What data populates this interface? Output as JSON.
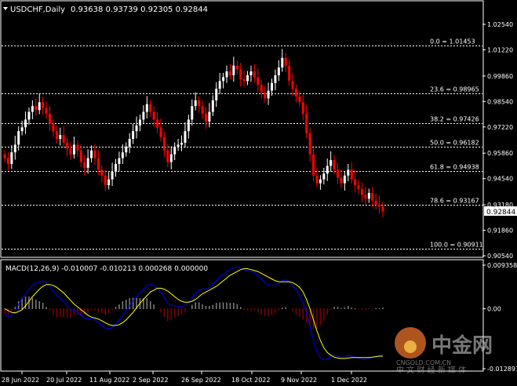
{
  "main": {
    "title": "USDCHF,Daily",
    "ohlc": "0.93638 0.93739 0.92305 0.92844",
    "price_axis": [
      "1.02540",
      "1.01220",
      "0.99860",
      "0.98540",
      "0.97220",
      "0.95860",
      "0.94540",
      "0.93180",
      "0.91860",
      "0.90540"
    ],
    "price_tag": "0.92844",
    "fib_levels": [
      {
        "label": "0.0 = 1.01453",
        "price": 1.01453
      },
      {
        "label": "23.6 = 0.98965",
        "price": 0.98965
      },
      {
        "label": "38.2 = 0.97426",
        "price": 0.97426
      },
      {
        "label": "50.0 = 0.96182",
        "price": 0.96182
      },
      {
        "label": "61.8 = 0.94938",
        "price": 0.94938
      },
      {
        "label": "78.6 = 0.93167",
        "price": 0.93167
      },
      {
        "label": "100.0 = 0.90911",
        "price": 0.90911
      }
    ]
  },
  "macd": {
    "title": "MACD(12,26,9) -0.010007 -0.010213 0.000268 0.000000",
    "axis": [
      "0.009358",
      "0.00",
      "-0.012897"
    ]
  },
  "time_axis": [
    "28 Jun 2022",
    "20 Jul 2022",
    "11 Aug 2022",
    "2 Sep 2022",
    "26 Sep 2022",
    "18 Oct 2022",
    "9 Nov 2022",
    "1 Dec 2022"
  ],
  "watermark": {
    "brand": "中金网",
    "domain": "CNGOLD.COM.CN",
    "slogan": "中 文 财 经 新 媒 体"
  },
  "colors": {
    "bull": "#ffffff",
    "bear": "#ff0000",
    "macd_line": "#0000ff",
    "signal_line": "#ffff00",
    "grid": "#ffffff",
    "fib": "#ffffff"
  },
  "chart_data": [
    {
      "type": "candlestick",
      "title": "USDCHF,Daily",
      "xlabel": "",
      "ylabel": "",
      "ylim": [
        0.9054,
        1.0254
      ],
      "x_ticks": [
        "28 Jun 2022",
        "20 Jul 2022",
        "11 Aug 2022",
        "2 Sep 2022",
        "26 Sep 2022",
        "18 Oct 2022",
        "9 Nov 2022",
        "1 Dec 2022"
      ],
      "closes": [
        0.956,
        0.953,
        0.959,
        0.963,
        0.97,
        0.972,
        0.976,
        0.98,
        0.983,
        0.981,
        0.985,
        0.982,
        0.979,
        0.974,
        0.97,
        0.966,
        0.968,
        0.964,
        0.961,
        0.958,
        0.963,
        0.96,
        0.954,
        0.951,
        0.956,
        0.96,
        0.956,
        0.95,
        0.947,
        0.942,
        0.945,
        0.949,
        0.953,
        0.956,
        0.959,
        0.962,
        0.966,
        0.97,
        0.973,
        0.976,
        0.98,
        0.984,
        0.98,
        0.976,
        0.972,
        0.967,
        0.96,
        0.954,
        0.958,
        0.962,
        0.963,
        0.964,
        0.97,
        0.976,
        0.983,
        0.986,
        0.983,
        0.979,
        0.975,
        0.98,
        0.986,
        0.992,
        0.996,
        0.998,
        1.001,
        0.999,
        1.004,
        1.002,
        0.997,
        0.996,
        0.999,
        1.001,
        0.998,
        0.994,
        0.99,
        0.987,
        0.991,
        0.995,
        0.999,
        1.003,
        1.008,
        1.004,
        0.996,
        0.992,
        0.988,
        0.985,
        0.979,
        0.969,
        0.958,
        0.947,
        0.943,
        0.945,
        0.948,
        0.952,
        0.955,
        0.95,
        0.946,
        0.943,
        0.947,
        0.95,
        0.945,
        0.942,
        0.94,
        0.937,
        0.935,
        0.938,
        0.934,
        0.932,
        0.931,
        0.9284
      ]
    },
    {
      "type": "line",
      "title": "MACD(12,26,9) -0.010007 -0.010213 0.000268 0.000000",
      "xlabel": "",
      "ylabel": "",
      "ylim": [
        -0.012897,
        0.009358
      ],
      "series": [
        {
          "name": "MACD",
          "values": [
            -0.001,
            -0.0018,
            -0.0015,
            -0.0005,
            0.001,
            0.0022,
            0.0032,
            0.0042,
            0.005,
            0.0054,
            0.0058,
            0.006,
            0.0056,
            0.0048,
            0.0038,
            0.0028,
            0.0022,
            0.0014,
            0.0006,
            -0.0002,
            -0.0004,
            -0.0008,
            -0.0014,
            -0.002,
            -0.0022,
            -0.002,
            -0.0024,
            -0.003,
            -0.0036,
            -0.0042,
            -0.0044,
            -0.004,
            -0.0032,
            -0.0024,
            -0.0014,
            -0.0004,
            0.0006,
            0.0016,
            0.0026,
            0.0034,
            0.0042,
            0.005,
            0.0052,
            0.005,
            0.0044,
            0.0036,
            0.0024,
            0.0012,
            0.0008,
            0.0006,
            0.0004,
            0.0004,
            0.0008,
            0.0014,
            0.0024,
            0.0034,
            0.004,
            0.0042,
            0.0042,
            0.0046,
            0.0052,
            0.006,
            0.0068,
            0.0074,
            0.008,
            0.0084,
            0.0088,
            0.009,
            0.0088,
            0.0084,
            0.0082,
            0.008,
            0.0078,
            0.0072,
            0.0064,
            0.0056,
            0.0052,
            0.005,
            0.005,
            0.0054,
            0.006,
            0.0062,
            0.0058,
            0.005,
            0.004,
            0.0028,
            0.0012,
            -0.001,
            -0.0038,
            -0.0068,
            -0.0092,
            -0.0105,
            -0.011,
            -0.0108,
            -0.0102,
            -0.01,
            -0.0102,
            -0.0106,
            -0.0104,
            -0.01,
            -0.0102,
            -0.0104,
            -0.0106,
            -0.0108,
            -0.0109,
            -0.0106,
            -0.0104,
            -0.0102,
            -0.0101,
            -0.01
          ]
        },
        {
          "name": "Signal",
          "values": [
            0.0,
            -0.0004,
            -0.0008,
            -0.0009,
            -0.0006,
            -0.0002,
            0.0006,
            0.0016,
            0.0026,
            0.0034,
            0.0042,
            0.0048,
            0.0052,
            0.0052,
            0.005,
            0.0046,
            0.004,
            0.0034,
            0.0026,
            0.0018,
            0.001,
            0.0004,
            -0.0002,
            -0.0008,
            -0.0014,
            -0.0018,
            -0.002,
            -0.0022,
            -0.0026,
            -0.003,
            -0.0034,
            -0.0036,
            -0.0036,
            -0.0034,
            -0.003,
            -0.0024,
            -0.0016,
            -0.0008,
            0.0002,
            0.0012,
            0.002,
            0.0028,
            0.0036,
            0.004,
            0.0044,
            0.0044,
            0.0042,
            0.0038,
            0.0032,
            0.0026,
            0.002,
            0.0016,
            0.0014,
            0.0014,
            0.0016,
            0.002,
            0.0026,
            0.0032,
            0.0036,
            0.004,
            0.0044,
            0.0048,
            0.0054,
            0.006,
            0.0066,
            0.0072,
            0.0076,
            0.008,
            0.0084,
            0.0086,
            0.0086,
            0.0084,
            0.0082,
            0.008,
            0.0076,
            0.0072,
            0.0068,
            0.0064,
            0.006,
            0.0058,
            0.0058,
            0.0058,
            0.0058,
            0.0056,
            0.0052,
            0.0046,
            0.0036,
            0.002,
            0.0,
            -0.0024,
            -0.0048,
            -0.0068,
            -0.0084,
            -0.0094,
            -0.01,
            -0.0104,
            -0.0106,
            -0.0107,
            -0.0107,
            -0.0106,
            -0.0105,
            -0.0105,
            -0.0105,
            -0.0105,
            -0.0105,
            -0.0105,
            -0.0104,
            -0.0103,
            -0.0102,
            -0.0102
          ]
        },
        {
          "name": "Histogram",
          "values": [
            -0.001,
            -0.0014,
            -0.0007,
            0.0004,
            0.0016,
            0.0024,
            0.0026,
            0.0026,
            0.0024,
            0.002,
            0.0016,
            0.0012,
            0.0004,
            -0.0004,
            -0.0012,
            -0.0018,
            -0.0018,
            -0.002,
            -0.002,
            -0.002,
            -0.0014,
            -0.0012,
            -0.0012,
            -0.0012,
            -0.0008,
            -0.0002,
            -0.0004,
            -0.0008,
            -0.001,
            -0.0012,
            -0.001,
            -0.0004,
            0.0004,
            0.001,
            0.0016,
            0.002,
            0.0022,
            0.0024,
            0.0024,
            0.0022,
            0.0022,
            0.0022,
            0.0016,
            0.001,
            0.0,
            -0.0008,
            -0.0018,
            -0.0026,
            -0.0024,
            -0.002,
            -0.0016,
            -0.0012,
            -0.0006,
            0.0,
            0.0008,
            0.0014,
            0.0014,
            0.001,
            0.0006,
            0.0006,
            0.0008,
            0.0012,
            0.0014,
            0.0014,
            0.0014,
            0.0012,
            0.0012,
            0.001,
            0.0004,
            -0.0002,
            -0.0004,
            -0.0004,
            -0.0004,
            -0.0008,
            -0.0012,
            -0.0016,
            -0.0016,
            -0.0014,
            -0.001,
            -0.0004,
            0.0002,
            0.0004,
            0.0,
            -0.0006,
            -0.0012,
            -0.0018,
            -0.0024,
            -0.003,
            -0.0038,
            -0.0044,
            -0.0044,
            -0.0037,
            -0.0026,
            -0.0014,
            -0.0002,
            0.0004,
            0.0004,
            0.0001,
            0.0003,
            0.0006,
            0.0003,
            0.0001,
            -0.0001,
            -0.0003,
            -0.0004,
            -0.0001,
            0.0,
            0.0001,
            0.0001,
            0.0002
          ]
        }
      ]
    }
  ]
}
